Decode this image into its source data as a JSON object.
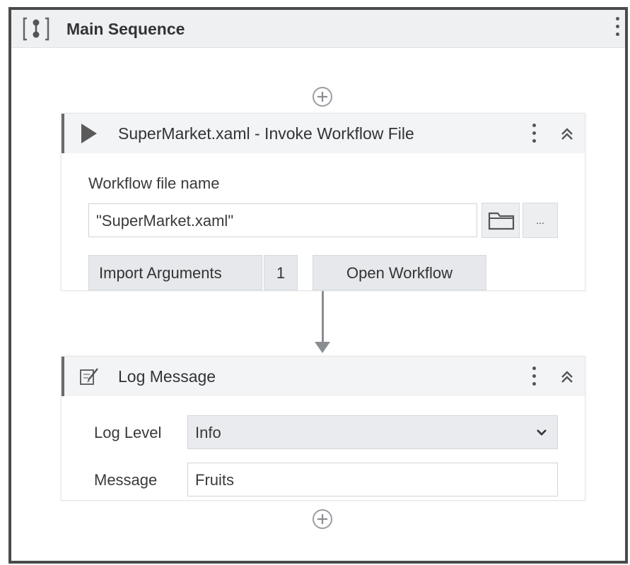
{
  "sequence": {
    "title": "Main Sequence",
    "icon": "sequence-icon"
  },
  "invoke_activity": {
    "title": "SuperMarket.xaml - Invoke Workflow File",
    "icon": "play-icon",
    "workflow_label": "Workflow file name",
    "workflow_value": "\"SuperMarket.xaml\"",
    "browse_label": "...",
    "import_label": "Import Arguments",
    "import_count": "1",
    "open_label": "Open Workflow"
  },
  "log_activity": {
    "title": "Log Message",
    "icon": "log-message-icon",
    "level_label": "Log Level",
    "level_value": "Info",
    "message_label": "Message",
    "message_value": "Fruits"
  },
  "colors": {
    "frame_border": "#4a4a4a",
    "header_bg": "#eef0f2",
    "button_bg": "#e6e8eb",
    "connector": "#8a8d91"
  }
}
